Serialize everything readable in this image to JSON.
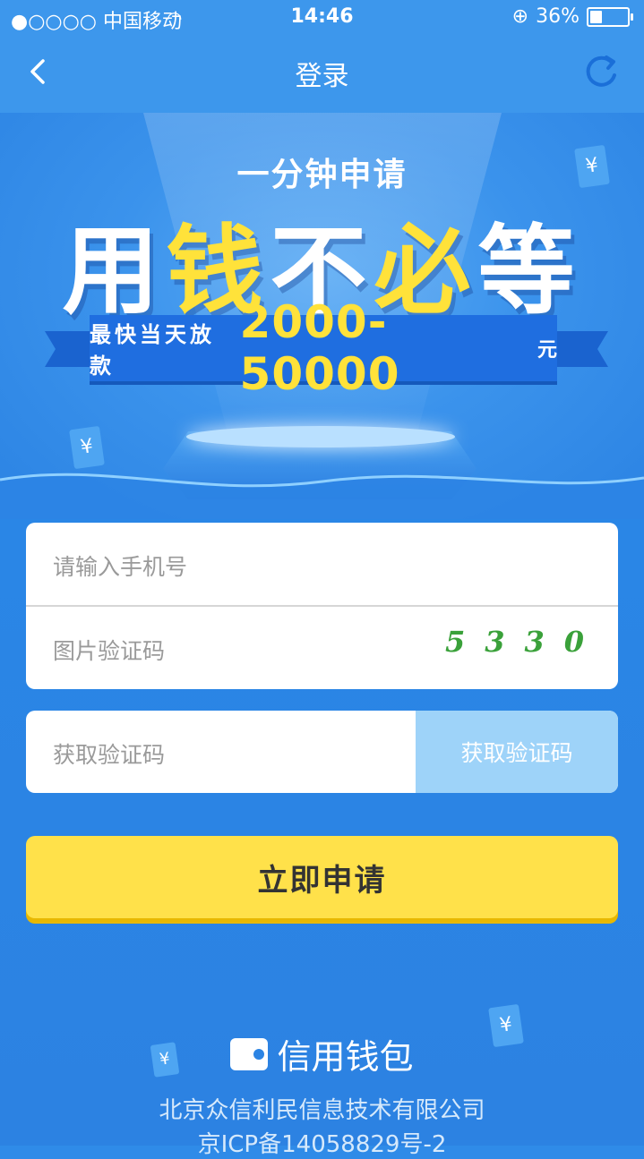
{
  "status_bar": {
    "carrier": "●○○○○ 中国移动",
    "time": "14:46",
    "battery_text": "36%",
    "battery_level": 0.36
  },
  "nav": {
    "title": "登录",
    "back_icon": "chevron-left-icon",
    "refresh_icon": "refresh-icon"
  },
  "banner": {
    "subtitle": "一分钟申请",
    "headline": [
      "用",
      "钱",
      "不",
      "必",
      "等"
    ],
    "ribbon_text": "最快当天放款",
    "amount": "2000-50000",
    "unit": "元",
    "coin_symbol": "¥"
  },
  "form": {
    "phone_placeholder": "请输入手机号",
    "captcha_placeholder": "图片验证码",
    "captcha_code": "5330",
    "sms_placeholder": "获取验证码",
    "sms_button": "获取验证码",
    "submit_label": "立即申请"
  },
  "footer": {
    "brand": "信用钱包",
    "company": "北京众信利民信息技术有限公司",
    "icp": "京ICP备14058829号-2"
  },
  "colors": {
    "primary": "#2f8be8",
    "accent_yellow": "#ffe14a",
    "sms_button": "#9ed3f9",
    "captcha": "#3aa13a"
  }
}
